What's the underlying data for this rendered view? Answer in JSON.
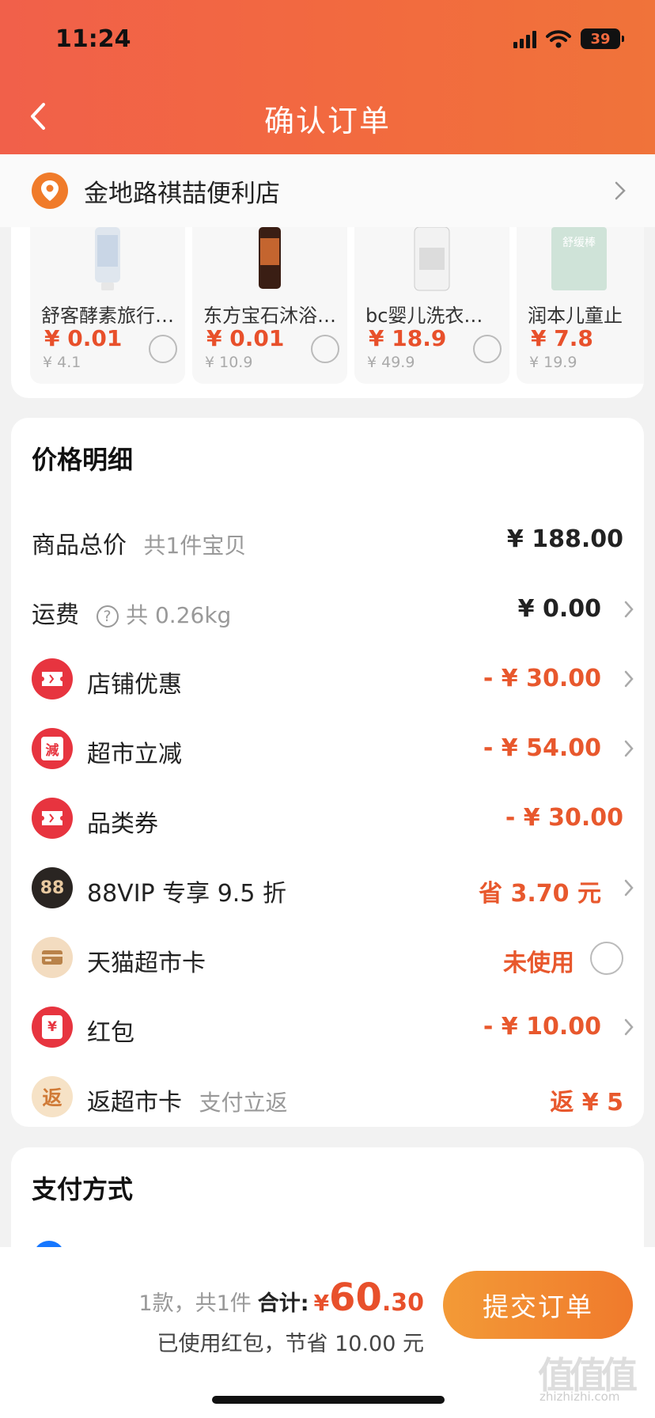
{
  "status_bar": {
    "time": "11:24",
    "battery": "39"
  },
  "nav": {
    "title": "确认订单"
  },
  "store": {
    "name": "金地路祺喆便利店"
  },
  "products": [
    {
      "name": "舒客酵素旅行…",
      "price": "¥ 0.01",
      "original": "¥ 4.1"
    },
    {
      "name": "东方宝石沐浴…",
      "price": "¥ 0.01",
      "original": "¥ 10.9"
    },
    {
      "name": "bc婴儿洗衣…",
      "price": "¥ 18.9",
      "original": "¥ 49.9"
    },
    {
      "name": "润本儿童止",
      "price": "¥ 7.8",
      "original": "¥ 19.9",
      "img_text": "舒缓棒"
    }
  ],
  "price_detail": {
    "title": "价格明细",
    "rows": [
      {
        "label": "商品总价",
        "sub": "共1件宝贝",
        "value": "¥ 188.00"
      },
      {
        "label": "运费",
        "sub": "共 0.26kg",
        "value": "¥ 0.00"
      },
      {
        "label": "店铺优惠",
        "value": "- ¥ 30.00"
      },
      {
        "label": "超市立减",
        "icon_text": "減",
        "value": "- ¥ 54.00"
      },
      {
        "label": "品类券",
        "value": "- ¥ 30.00"
      },
      {
        "label": "88VIP 专享 9.5 折",
        "icon_text": "88",
        "value": "省 3.70 元"
      },
      {
        "label": "天猫超市卡",
        "value": "未使用"
      },
      {
        "label": "红包",
        "icon_text": "¥",
        "value": "- ¥ 10.00"
      },
      {
        "label": "返超市卡",
        "sub": "支付立返",
        "icon_text": "返",
        "value": "返 ¥ 5"
      }
    ]
  },
  "payment": {
    "title": "支付方式"
  },
  "summary": {
    "count": "1款，共1件",
    "total_label": "合计:",
    "currency": "¥",
    "total_int": "60",
    "total_dec": ".30",
    "saving": "已使用红包，节省 10.00 元",
    "submit": "提交订单"
  },
  "watermark": {
    "text": "值值值",
    "sub": "zhizhizhi.com"
  },
  "colors": {
    "accent": "#e8502b",
    "header": "#f26a3f",
    "button": "#f08a32"
  }
}
